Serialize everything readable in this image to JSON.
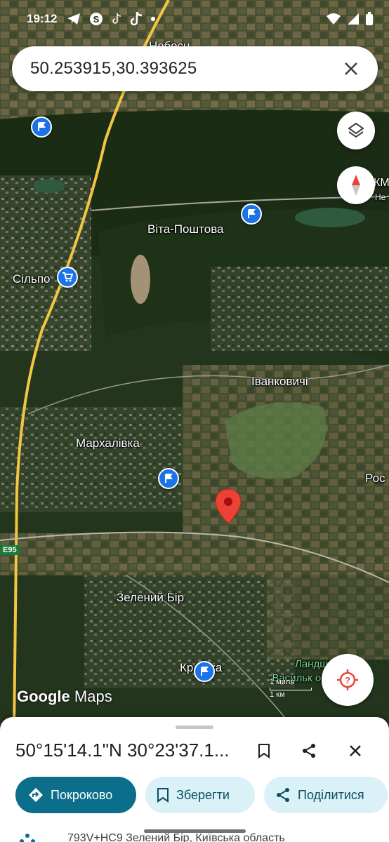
{
  "status_bar": {
    "time": "19:12"
  },
  "search": {
    "query": "50.253915,30.393625"
  },
  "map": {
    "labels": {
      "vita_poshtova": "Віта-Поштова",
      "silpo": "Сільпо",
      "ivankovychi": "Іванковичі",
      "markhalivka": "Мархалівка",
      "zelenyi_bir": "Зелений Бір",
      "krasylivka": "Кр    инка",
      "nebesna": "Небесн",
      "km_edge": "КМ",
      "ne_edge": "Не",
      "ros_edge": "Рос",
      "landscape_1": "Ландш      ний п",
      "landscape_2": "\"Васильк        опа",
      "scale": "1 миля",
      "scale_km": "1 км"
    },
    "road_shield": "E95",
    "attribution": {
      "google": "Google",
      "maps": "Maps"
    }
  },
  "place_sheet": {
    "coords": "50°15'14.1\"N 30°23'37.1...",
    "actions": {
      "directions": "Покроково",
      "save": "Зберегти",
      "share": "Поділитися"
    },
    "address": "793V+HC9 Зелений Бір, Київська область"
  },
  "icons": [
    "search-icon",
    "close-icon",
    "layers-icon",
    "compass-icon",
    "my-location-icon",
    "bookmark-icon",
    "share-icon",
    "directions-icon"
  ],
  "colors": {
    "accent": "#0b6e8a",
    "chip_bg": "#d9f1f7",
    "poi": "#1a73e8",
    "pin": "#ea4335"
  }
}
